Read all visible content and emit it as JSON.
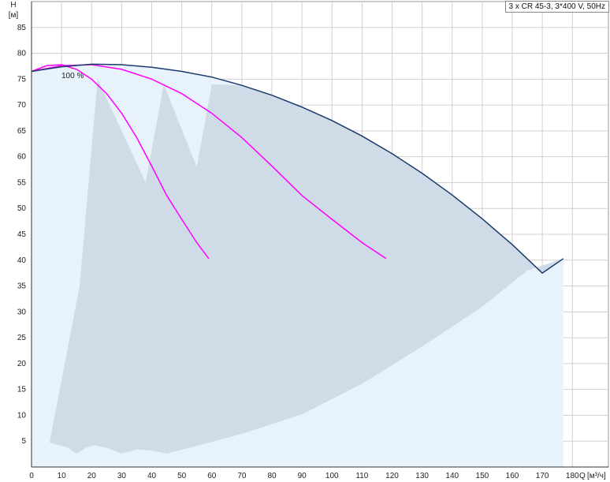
{
  "chart_data": {
    "type": "line",
    "title": "3 x CR 45-3, 3*400 V, 50Hz",
    "ylabel": "H",
    "yunit": "[м]",
    "xlabel": "Q",
    "xunit": "[м³/ч]",
    "xlim": [
      0,
      192
    ],
    "ylim": [
      0,
      90
    ],
    "xticks": [
      0,
      10,
      20,
      30,
      40,
      50,
      60,
      70,
      80,
      90,
      100,
      110,
      120,
      130,
      140,
      150,
      160,
      170,
      180
    ],
    "yticks": [
      5,
      10,
      15,
      20,
      25,
      30,
      35,
      40,
      45,
      50,
      55,
      60,
      65,
      70,
      75,
      80,
      85
    ],
    "grid": true,
    "curve_label": "100 %",
    "colors": {
      "pump_curve": "#ff00ff",
      "system_curve": "#1a3a6b",
      "work_area": "#cfdbe6",
      "light_area": "#e8f2fb"
    },
    "series": [
      {
        "x": [
          0,
          5,
          10,
          15,
          20,
          25,
          30,
          35,
          40,
          45,
          50,
          55,
          59
        ],
        "values": [
          76.5,
          77.6,
          77.8,
          76.9,
          75.0,
          72.2,
          68.4,
          63.7,
          58.2,
          52.5,
          47.9,
          43.4,
          40.3
        ]
      },
      {
        "x": [
          0,
          10,
          20,
          30,
          40,
          50,
          60,
          70,
          80,
          90,
          100,
          110,
          118
        ],
        "values": [
          76.5,
          77.6,
          77.8,
          76.9,
          75.0,
          72.2,
          68.4,
          63.7,
          58.2,
          52.5,
          47.9,
          43.4,
          40.3
        ]
      },
      {
        "x": [
          0,
          10,
          20,
          30,
          40,
          50,
          60,
          70,
          80,
          90,
          100,
          110,
          120,
          130,
          140,
          150,
          160,
          170,
          177
        ],
        "values": [
          76.5,
          77.4,
          77.9,
          77.8,
          77.3,
          76.5,
          75.4,
          73.8,
          71.9,
          69.6,
          67.0,
          64.0,
          60.6,
          56.8,
          52.6,
          48.0,
          43.0,
          37.5,
          40.3
        ]
      }
    ],
    "work_area": {
      "x": [
        6,
        12,
        15,
        18,
        21,
        25,
        30,
        35,
        40,
        45,
        55,
        70,
        90,
        110,
        130,
        150,
        165,
        177
      ],
      "lower": [
        4.7,
        3.8,
        2.6,
        3.7,
        4.2,
        3.7,
        2.6,
        3.4,
        3.2,
        2.6,
        4.1,
        6.4,
        10.2,
        16.1,
        23.3,
        31.0,
        38.0,
        40.3
      ]
    }
  }
}
